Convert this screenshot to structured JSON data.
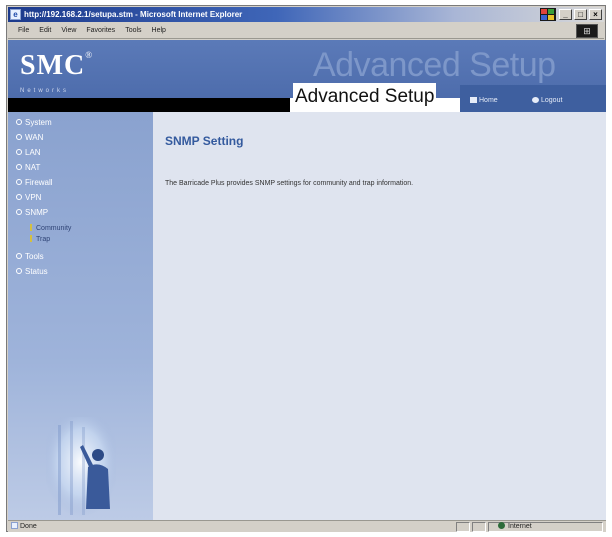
{
  "window": {
    "title": "http://192.168.2.1/setupa.stm - Microsoft Internet Explorer",
    "controls": [
      "_",
      "□",
      "×"
    ]
  },
  "menubar": {
    "items": [
      "File",
      "Edit",
      "View",
      "Favorites",
      "Tools",
      "Help"
    ]
  },
  "header": {
    "brand": "SMC",
    "brand_mark": "®",
    "brand_sub": "Networks",
    "watermark": "Advanced Setup",
    "title": "Advanced Setup",
    "home_label": "Home",
    "logout_label": "Logout"
  },
  "sidebar": {
    "items": [
      {
        "label": "System"
      },
      {
        "label": "WAN"
      },
      {
        "label": "LAN"
      },
      {
        "label": "NAT"
      },
      {
        "label": "Firewall"
      },
      {
        "label": "VPN"
      },
      {
        "label": "SNMP"
      },
      {
        "label": "Tools"
      },
      {
        "label": "Status"
      }
    ],
    "subitems": [
      {
        "label": "Community"
      },
      {
        "label": "Trap"
      }
    ]
  },
  "main": {
    "title": "SNMP Setting",
    "description": "The Barricade Plus provides SNMP settings for community and trap information."
  },
  "statusbar": {
    "status": "Done",
    "zone": "Internet"
  },
  "colors": {
    "header_blue": "#4a69a9",
    "sidebar_blue": "#8aa2cf",
    "title_blue": "#345a9e",
    "content_bg": "#dfe4ef"
  }
}
